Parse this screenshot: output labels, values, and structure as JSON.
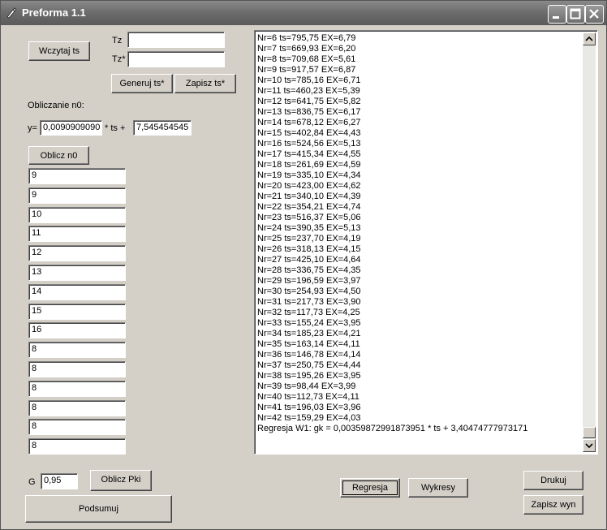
{
  "window": {
    "title": "Preforma 1.1"
  },
  "inputs": {
    "load_button": "Wczytaj ts",
    "tz_label": "Tz",
    "tz_value": "",
    "tzstar_label": "Tz*",
    "tzstar_value": "",
    "generate_button": "Generuj ts*",
    "save_button": "Zapisz ts*"
  },
  "n0": {
    "heading": "Obliczanie n0:",
    "y_label": "y=",
    "coef_value": "0,0090909090",
    "ts_label": "* ts +",
    "intercept_value": "7,545454545",
    "compute_button": "Oblicz n0",
    "values": [
      "9",
      "9",
      "10",
      "11",
      "12",
      "13",
      "14",
      "15",
      "16",
      "8",
      "8",
      "8",
      "8",
      "8",
      "8"
    ]
  },
  "pki": {
    "g_label": "G",
    "g_value": "0,95",
    "compute_button": "Oblicz Pki"
  },
  "summary_button": "Podsumuj",
  "results": {
    "lines": [
      "Nr=6 ts=795,75  EX=6,79",
      "Nr=7 ts=669,93  EX=6,20",
      "Nr=8 ts=709,68  EX=5,61",
      "Nr=9 ts=917,57  EX=6,87",
      "Nr=10 ts=785,16  EX=6,71",
      "Nr=11 ts=460,23  EX=5,39",
      "Nr=12 ts=641,75  EX=5,82",
      "Nr=13 ts=836,75  EX=6,17",
      "Nr=14 ts=678,12  EX=6,27",
      "Nr=15 ts=402,84  EX=4,43",
      "Nr=16 ts=524,56  EX=5,13",
      "Nr=17 ts=415,34  EX=4,55",
      "Nr=18 ts=261,69  EX=4,59",
      "Nr=19 ts=335,10  EX=4,34",
      "Nr=20 ts=423,00  EX=4,62",
      "Nr=21 ts=340,10  EX=4,39",
      "Nr=22 ts=354,21  EX=4,74",
      "Nr=23 ts=516,37  EX=5,06",
      "Nr=24 ts=390,35  EX=5,13",
      "Nr=25 ts=237,70  EX=4,19",
      "Nr=26 ts=318,13  EX=4,15",
      "Nr=27 ts=425,10  EX=4,64",
      "Nr=28 ts=336,75  EX=4,35",
      "Nr=29 ts=196,59  EX=3,97",
      "Nr=30 ts=254,93  EX=4,50",
      "Nr=31 ts=217,73  EX=3,90",
      "Nr=32 ts=117,73  EX=4,25",
      "Nr=33 ts=155,24  EX=3,95",
      "Nr=34 ts=185,23  EX=4,21",
      "Nr=35 ts=163,14  EX=4,11",
      "Nr=36 ts=146,78  EX=4,14",
      "Nr=37 ts=250,75  EX=4,44",
      "Nr=38 ts=195,26  EX=3,95",
      "Nr=39 ts=98,44  EX=3,99",
      "Nr=40 ts=112,73  EX=4,11",
      "Nr=41 ts=196,03  EX=3,96",
      "Nr=42 ts=159,29  EX=4,03",
      "Regresja W1: gk = 0,00359872991873951 * ts + 3,40474777973171"
    ]
  },
  "actions": {
    "regression_button": "Regresja",
    "charts_button": "Wykresy",
    "print_button": "Drukuj",
    "save_results_button": "Zapisz wyn"
  }
}
